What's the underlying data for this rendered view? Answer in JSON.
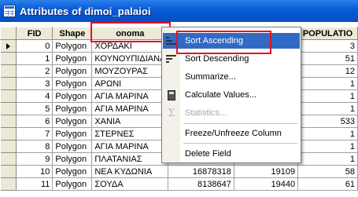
{
  "window": {
    "title": "Attributes of dimoi_palaioi"
  },
  "table": {
    "columns": [
      "FID",
      "Shape",
      "onoma",
      "",
      "",
      "POPULATIO"
    ],
    "partial_headers": {
      "col4": "a",
      "col5": "metrop"
    },
    "rows": [
      {
        "fid": "0",
        "shape": "Polygon",
        "onoma": "ΧΟΡΔΑΚΙ",
        "c4": "",
        "c5": "",
        "pop": "3"
      },
      {
        "fid": "1",
        "shape": "Polygon",
        "onoma": "ΚΟΥΝΟΥΠΙΔΙΑΝΑ",
        "c4": "",
        "c5": "",
        "pop": "51"
      },
      {
        "fid": "2",
        "shape": "Polygon",
        "onoma": "ΜΟΥΖΟΥΡΑΣ",
        "c4": "",
        "c5": "",
        "pop": "12"
      },
      {
        "fid": "3",
        "shape": "Polygon",
        "onoma": "ΑΡΩΝΙ",
        "c4": "",
        "c5": "",
        "pop": "1"
      },
      {
        "fid": "4",
        "shape": "Polygon",
        "onoma": "ΑΓΙΑ ΜΑΡΙΝΑ",
        "c4": "",
        "c5": "",
        "pop": "1"
      },
      {
        "fid": "5",
        "shape": "Polygon",
        "onoma": "ΑΓΙΑ ΜΑΡΙΝΑ",
        "c4": "",
        "c5": "",
        "pop": "1"
      },
      {
        "fid": "6",
        "shape": "Polygon",
        "onoma": "ΧΑΝΙΑ",
        "c4": "",
        "c5": "",
        "pop": "533"
      },
      {
        "fid": "7",
        "shape": "Polygon",
        "onoma": "ΣΤΕΡΝΕΣ",
        "c4": "",
        "c5": "",
        "pop": "1"
      },
      {
        "fid": "8",
        "shape": "Polygon",
        "onoma": "ΑΓΙΑ ΜΑΡΙΝΑ",
        "c4": "",
        "c5": "",
        "pop": "1"
      },
      {
        "fid": "9",
        "shape": "Polygon",
        "onoma": "ΠΛΑΤΑΝΙΑΣ",
        "c4": "",
        "c5": "",
        "pop": "1"
      },
      {
        "fid": "10",
        "shape": "Polygon",
        "onoma": "ΝΕΑ ΚΥΔΩΝΙΑ",
        "c4": "16878318",
        "c5": "19109",
        "pop": "58"
      },
      {
        "fid": "11",
        "shape": "Polygon",
        "onoma": "ΣΟΥΔΑ",
        "c4": "8138647",
        "c5": "19440",
        "pop": "61"
      }
    ]
  },
  "context_menu": {
    "items": [
      {
        "label": "Sort Ascending",
        "icon": "sort-ascending-icon",
        "state": "active"
      },
      {
        "label": "Sort Descending",
        "icon": "sort-descending-icon",
        "state": "normal"
      },
      {
        "label": "Summarize...",
        "icon": "",
        "state": "normal"
      },
      {
        "label": "Calculate Values...",
        "icon": "calculator-icon",
        "state": "normal"
      },
      {
        "label": "Statistics...",
        "icon": "sigma-icon",
        "state": "disabled"
      },
      {
        "label": "Freeze/Unfreeze Column",
        "icon": "",
        "state": "normal"
      },
      {
        "label": "Delete Field",
        "icon": "",
        "state": "normal"
      }
    ]
  },
  "colors": {
    "titlebar": "#0a5ed8",
    "highlight": "#316ac5",
    "annotation_outline": "#e3102a",
    "header_bg": "#ece9d8"
  }
}
